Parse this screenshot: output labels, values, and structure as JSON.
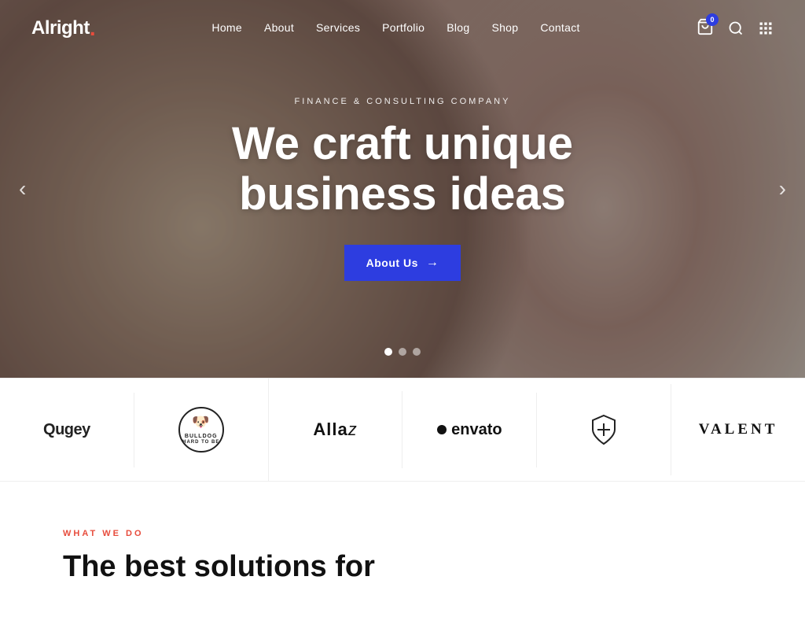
{
  "site": {
    "logo_text": "Alright",
    "logo_dot": ".",
    "cart_count": "0"
  },
  "navbar": {
    "links": [
      {
        "label": "Home",
        "id": "home"
      },
      {
        "label": "About",
        "id": "about"
      },
      {
        "label": "Services",
        "id": "services"
      },
      {
        "label": "Portfolio",
        "id": "portfolio"
      },
      {
        "label": "Blog",
        "id": "blog"
      },
      {
        "label": "Shop",
        "id": "shop"
      },
      {
        "label": "Contact",
        "id": "contact"
      }
    ]
  },
  "hero": {
    "subtitle": "Finance & Consulting Company",
    "title_line1": "We craft unique",
    "title_line2": "business ideas",
    "cta_label": "About Us",
    "dots": [
      "active",
      "",
      ""
    ],
    "arrow_left": "‹",
    "arrow_right": "›"
  },
  "logos": [
    {
      "id": "qugey",
      "type": "text",
      "text": "Qugey"
    },
    {
      "id": "bulldog",
      "type": "bulldog",
      "line1": "BULLDOG",
      "line2": "HARD TO BE"
    },
    {
      "id": "allaz",
      "type": "allaz",
      "text": "Allaz"
    },
    {
      "id": "envato",
      "type": "envato",
      "text": "envato"
    },
    {
      "id": "shield",
      "type": "shield"
    },
    {
      "id": "valent",
      "type": "valent",
      "text": "VALENT"
    }
  ],
  "what_we_do": {
    "label": "WHAT WE DO",
    "title_part1": "The best solutions for"
  }
}
